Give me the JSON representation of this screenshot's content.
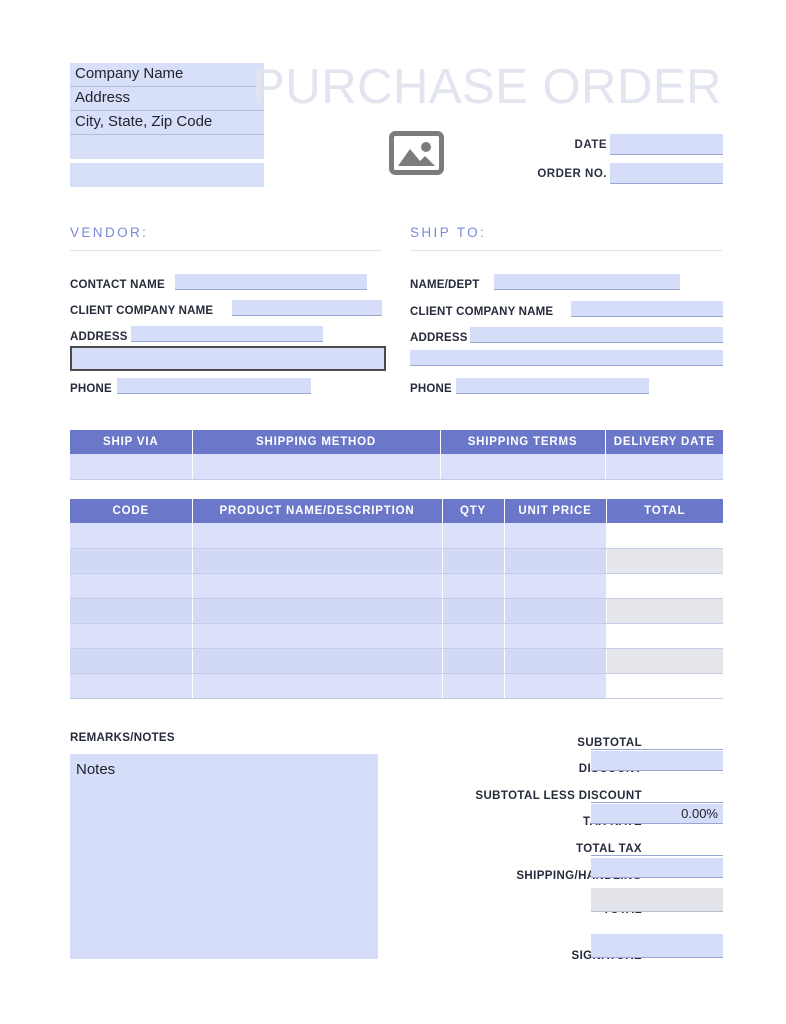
{
  "document": {
    "title": "PURCHASE ORDER",
    "logo_icon": "image-placeholder-icon"
  },
  "company_block": {
    "lines": [
      "Company Name",
      "Address",
      "City, State, Zip Code",
      "",
      ""
    ]
  },
  "meta": {
    "date_label": "DATE",
    "date_value": "",
    "order_no_label": "ORDER NO.",
    "order_no_value": ""
  },
  "vendor": {
    "heading": "VENDOR:",
    "fields": [
      {
        "label": "CONTACT NAME",
        "value": ""
      },
      {
        "label": "CLIENT COMPANY NAME",
        "value": ""
      },
      {
        "label": "ADDRESS",
        "value": ""
      },
      {
        "label": "",
        "value": ""
      },
      {
        "label": "PHONE",
        "value": ""
      }
    ]
  },
  "ship_to": {
    "heading": "SHIP TO:",
    "fields": [
      {
        "label": "NAME/DEPT",
        "value": ""
      },
      {
        "label": "CLIENT COMPANY NAME",
        "value": ""
      },
      {
        "label": "ADDRESS",
        "value": ""
      },
      {
        "label": "",
        "value": ""
      },
      {
        "label": "PHONE",
        "value": ""
      }
    ]
  },
  "shipping_table": {
    "headers": [
      "SHIP VIA",
      "SHIPPING METHOD",
      "SHIPPING TERMS",
      "DELIVERY DATE"
    ],
    "rows": [
      [
        "",
        "",
        "",
        ""
      ]
    ]
  },
  "items_table": {
    "headers": [
      "CODE",
      "PRODUCT NAME/DESCRIPTION",
      "QTY",
      "UNIT PRICE",
      "TOTAL"
    ],
    "rows": [
      [
        "",
        "",
        "",
        "",
        ""
      ],
      [
        "",
        "",
        "",
        "",
        ""
      ],
      [
        "",
        "",
        "",
        "",
        ""
      ],
      [
        "",
        "",
        "",
        "",
        ""
      ],
      [
        "",
        "",
        "",
        "",
        ""
      ],
      [
        "",
        "",
        "",
        "",
        ""
      ],
      [
        "",
        "",
        "",
        "",
        ""
      ]
    ]
  },
  "remarks": {
    "label": "REMARKS/NOTES",
    "value": "Notes"
  },
  "totals": {
    "rows": [
      {
        "label": "SUBTOTAL",
        "value": "",
        "style": "line"
      },
      {
        "label": "DISCOUNT",
        "value": "",
        "style": "field"
      },
      {
        "label": "SUBTOTAL LESS DISCOUNT",
        "value": "",
        "style": "line"
      },
      {
        "label": "TAX RATE",
        "value": "0.00%",
        "style": "field"
      },
      {
        "label": "TOTAL TAX",
        "value": "",
        "style": "line"
      },
      {
        "label": "SHIPPING/HANDLING",
        "value": "",
        "style": "field"
      },
      {
        "label": "TOTAL",
        "value": "",
        "style": "gray"
      },
      {
        "label": "SIGNATURE",
        "value": "",
        "style": "field"
      }
    ]
  },
  "colors": {
    "header_blue": "#6b78c9",
    "field_lavender": "#d5ddf8",
    "row_lavender": "#dbe1fa",
    "row_alt_lavender": "#d2d9f4",
    "total_gray": "#e2e4ea",
    "title_gray": "#e2e5f0",
    "heading_periwinkle": "#7a88d8",
    "text_navy": "#262b3b"
  }
}
